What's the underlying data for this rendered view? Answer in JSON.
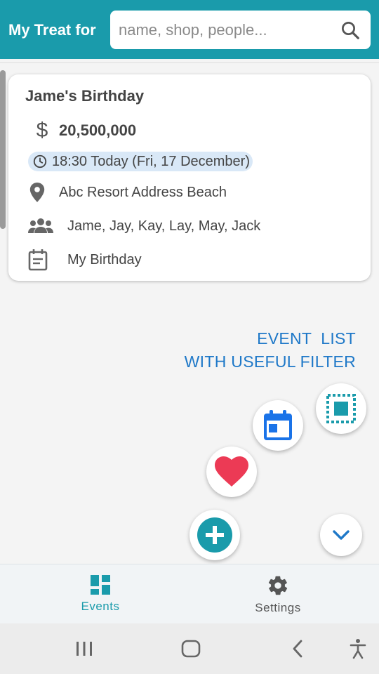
{
  "app": {
    "title": "My Treat for"
  },
  "search": {
    "placeholder": "name, shop, people..."
  },
  "event_card": {
    "title": "Jame's Birthday",
    "amount": "20,500,000",
    "currency_symbol": "$",
    "time": "18:30 Today (Fri, 17 December)",
    "location": "Abc Resort Address Beach",
    "people": "Jame, Jay, Kay, Lay, May, Jack",
    "note": "My Birthday"
  },
  "promo": {
    "line1": "EVENT  LIST",
    "line2": "WITH USEFUL FILTER"
  },
  "fabs": [
    "select-all-icon",
    "calendar-icon",
    "heart-icon",
    "add-circle-icon",
    "chevron-down-icon"
  ],
  "bottom_nav": {
    "items": [
      {
        "label": "Events",
        "icon": "dashboard-icon",
        "active": true
      },
      {
        "label": "Settings",
        "icon": "gear-icon",
        "active": false
      }
    ]
  },
  "colors": {
    "primary": "#1a9bab",
    "accent_blue": "#1e78c8",
    "heart_red": "#ec3a55",
    "calendar_blue": "#1a73e8",
    "time_chip_bg": "#d9e8f7"
  }
}
